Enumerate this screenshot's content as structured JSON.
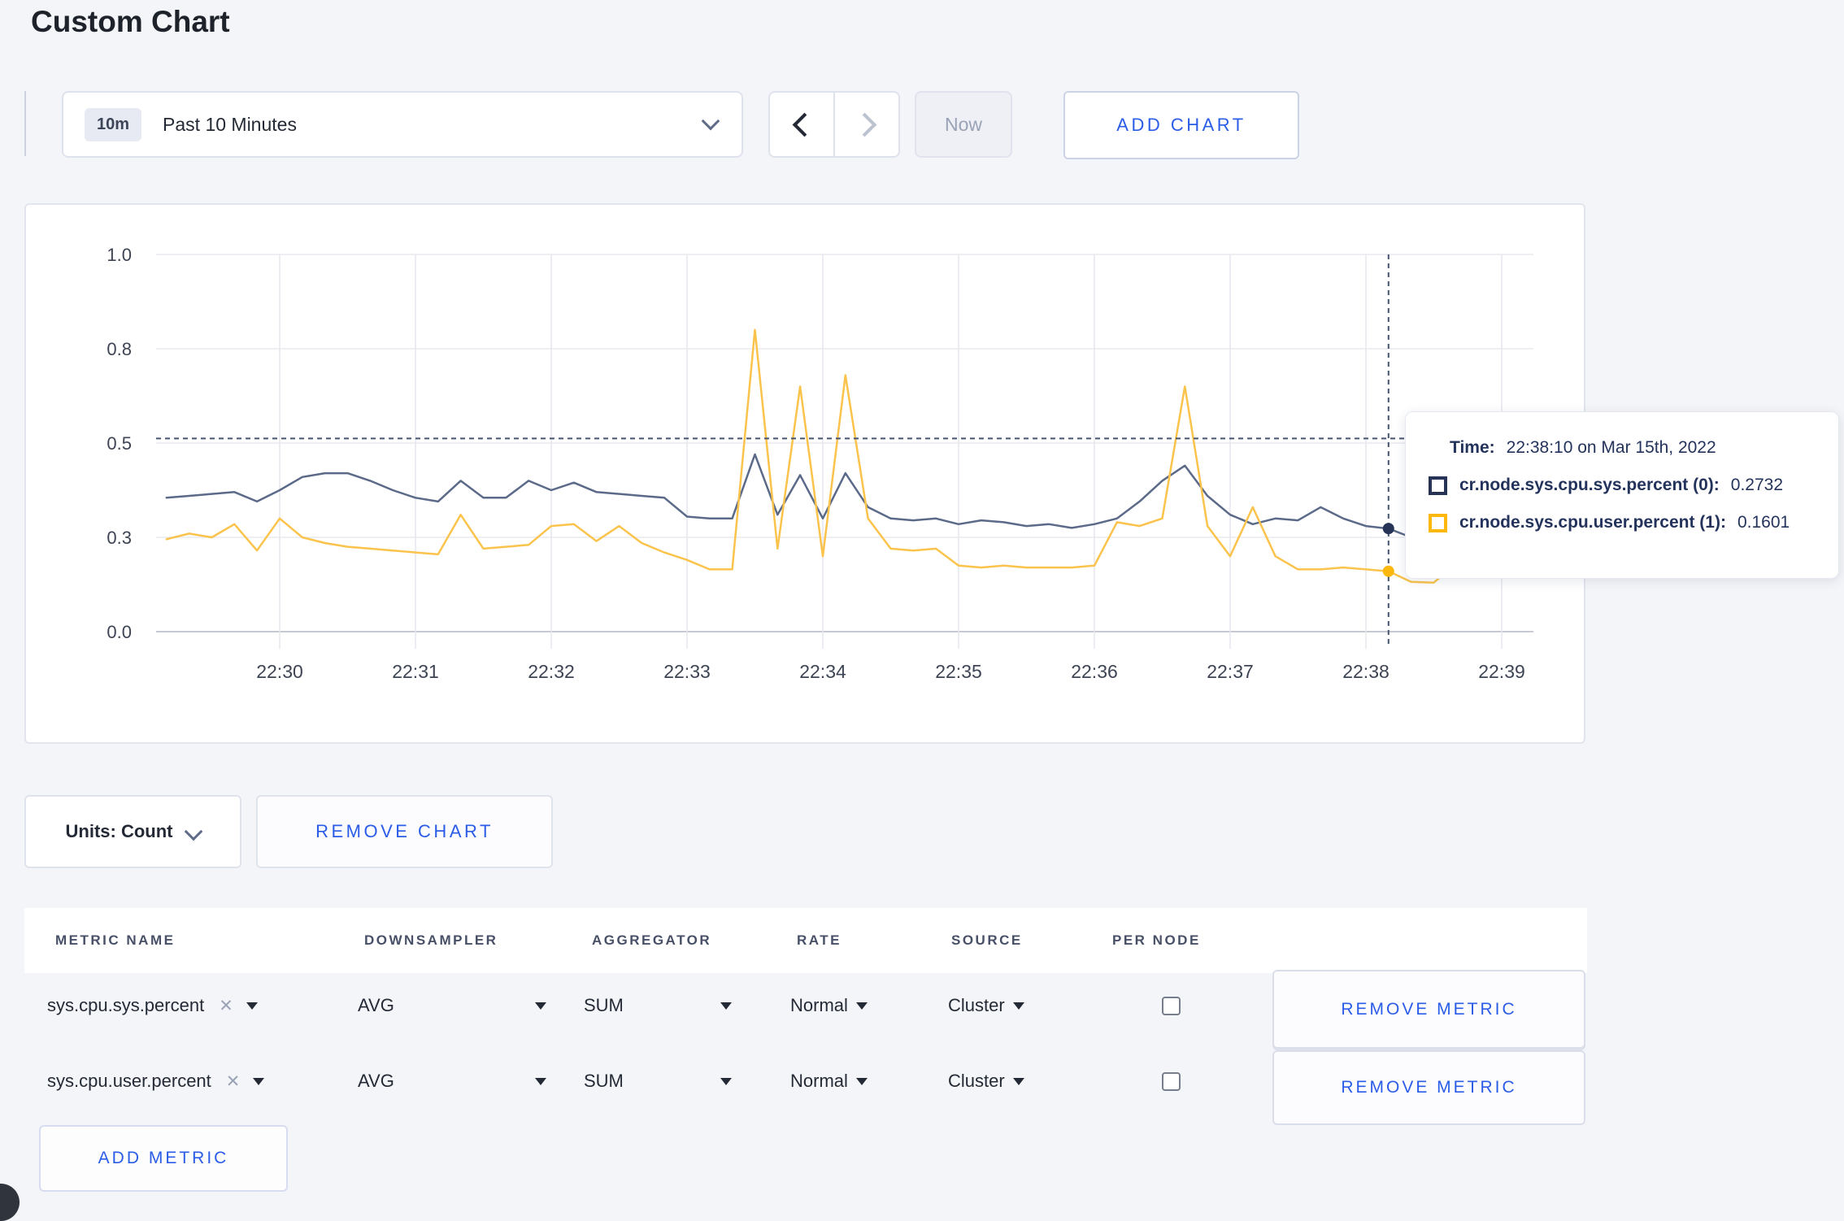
{
  "page": {
    "title": "Custom Chart",
    "accent_blue": "#2b5ce8",
    "background": "#f4f5f9"
  },
  "toolbar": {
    "time_range": {
      "badge": "10m",
      "label": "Past 10 Minutes"
    },
    "now_label": "Now",
    "add_chart_label": "ADD CHART"
  },
  "chart": {
    "tooltip": {
      "time_label": "Time:",
      "time_value": "22:38:10 on Mar 15th, 2022",
      "series": [
        {
          "label": "cr.node.sys.cpu.sys.percent (0):",
          "value": "0.2732",
          "color": "#263357"
        },
        {
          "label": "cr.node.sys.cpu.user.percent (1):",
          "value": "0.1601",
          "color": "#fcb80c"
        }
      ]
    }
  },
  "chart_data": {
    "type": "line",
    "title": "",
    "xlabel": "",
    "ylabel": "",
    "ylim": [
      0,
      1
    ],
    "grid": true,
    "legend_position": "none",
    "y_tick_values": [
      0,
      0.25,
      0.5,
      0.75,
      1.0
    ],
    "y_tick_labels": [
      "0.0",
      "0.3",
      "0.5",
      "0.8",
      "1.0"
    ],
    "x_tick_labels": [
      "22:30",
      "22:31",
      "22:32",
      "22:33",
      "22:34",
      "22:35",
      "22:36",
      "22:37",
      "22:38",
      "22:39"
    ],
    "x": [
      "22:29:10",
      "22:29:20",
      "22:29:30",
      "22:29:40",
      "22:29:50",
      "22:30:00",
      "22:30:10",
      "22:30:20",
      "22:30:30",
      "22:30:40",
      "22:30:50",
      "22:31:00",
      "22:31:10",
      "22:31:20",
      "22:31:30",
      "22:31:40",
      "22:31:50",
      "22:32:00",
      "22:32:10",
      "22:32:20",
      "22:32:30",
      "22:32:40",
      "22:32:50",
      "22:33:00",
      "22:33:10",
      "22:33:20",
      "22:33:30",
      "22:33:40",
      "22:33:50",
      "22:34:00",
      "22:34:10",
      "22:34:20",
      "22:34:30",
      "22:34:40",
      "22:34:50",
      "22:35:00",
      "22:35:10",
      "22:35:20",
      "22:35:30",
      "22:35:40",
      "22:35:50",
      "22:36:00",
      "22:36:10",
      "22:36:20",
      "22:36:30",
      "22:36:40",
      "22:36:50",
      "22:37:00",
      "22:37:10",
      "22:37:20",
      "22:37:30",
      "22:37:40",
      "22:37:50",
      "22:38:00",
      "22:38:10",
      "22:38:20",
      "22:38:30",
      "22:38:40",
      "22:38:50",
      "22:39:00"
    ],
    "series": [
      {
        "name": "cr.node.sys.cpu.sys.percent",
        "color": "#5b6a88",
        "point_color": "#263357",
        "values": [
          0.355,
          0.36,
          0.365,
          0.37,
          0.345,
          0.375,
          0.41,
          0.42,
          0.42,
          0.4,
          0.375,
          0.355,
          0.345,
          0.4,
          0.355,
          0.355,
          0.4,
          0.375,
          0.395,
          0.37,
          0.365,
          0.36,
          0.355,
          0.305,
          0.3,
          0.3,
          0.47,
          0.31,
          0.415,
          0.3,
          0.42,
          0.33,
          0.3,
          0.295,
          0.3,
          0.285,
          0.295,
          0.29,
          0.28,
          0.285,
          0.275,
          0.285,
          0.3,
          0.345,
          0.4,
          0.44,
          0.36,
          0.31,
          0.285,
          0.3,
          0.295,
          0.33,
          0.3,
          0.28,
          0.2732,
          0.25,
          0.26,
          0.275,
          0.28,
          0.27
        ]
      },
      {
        "name": "cr.node.sys.cpu.user.percent",
        "color": "#fbc34c",
        "point_color": "#fcb80c",
        "values": [
          0.245,
          0.26,
          0.25,
          0.285,
          0.215,
          0.3,
          0.25,
          0.235,
          0.225,
          0.22,
          0.215,
          0.21,
          0.205,
          0.31,
          0.22,
          0.225,
          0.23,
          0.28,
          0.285,
          0.24,
          0.28,
          0.235,
          0.21,
          0.19,
          0.165,
          0.165,
          0.8,
          0.22,
          0.65,
          0.2,
          0.68,
          0.3,
          0.22,
          0.215,
          0.22,
          0.175,
          0.17,
          0.175,
          0.17,
          0.17,
          0.17,
          0.175,
          0.29,
          0.28,
          0.3,
          0.65,
          0.28,
          0.2,
          0.33,
          0.2,
          0.165,
          0.165,
          0.17,
          0.165,
          0.1601,
          0.132,
          0.13,
          0.18,
          0.215,
          0.17
        ]
      }
    ],
    "crosshair": {
      "index": 54,
      "time": "22:38:10",
      "y_value": 0.512
    }
  },
  "units_row": {
    "units_label": "Units: Count",
    "remove_chart_label": "REMOVE CHART"
  },
  "metrics_table": {
    "headers": [
      "METRIC NAME",
      "DOWNSAMPLER",
      "AGGREGATOR",
      "RATE",
      "SOURCE",
      "PER NODE"
    ],
    "rows": [
      {
        "metric_name": "sys.cpu.sys.percent",
        "downsampler": "AVG",
        "aggregator": "SUM",
        "rate": "Normal",
        "source": "Cluster",
        "per_node": false,
        "remove_label": "REMOVE METRIC"
      },
      {
        "metric_name": "sys.cpu.user.percent",
        "downsampler": "AVG",
        "aggregator": "SUM",
        "rate": "Normal",
        "source": "Cluster",
        "per_node": false,
        "remove_label": "REMOVE METRIC"
      }
    ],
    "add_metric_label": "ADD METRIC"
  }
}
